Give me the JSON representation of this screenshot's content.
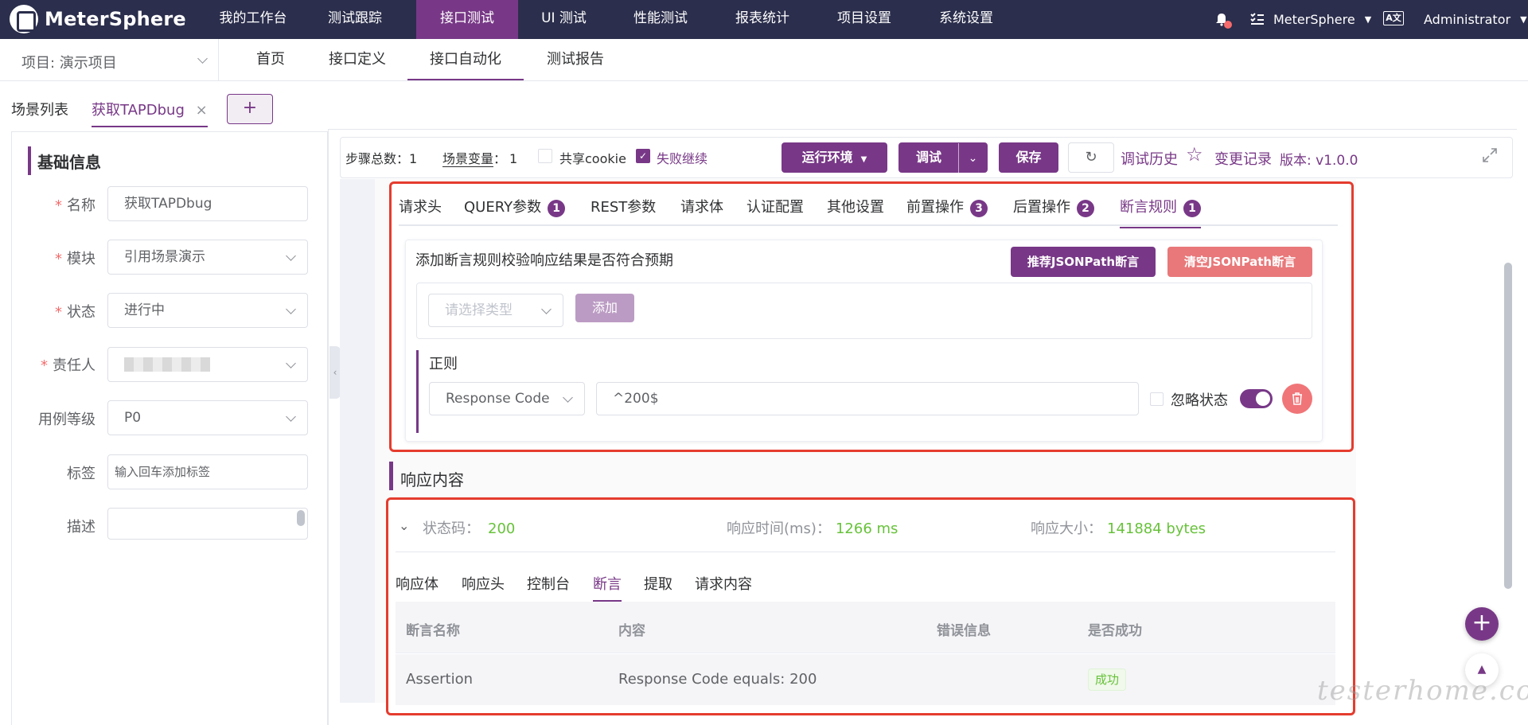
{
  "app": {
    "name": "MeterSphere"
  },
  "topnav": {
    "items": [
      "我的工作台",
      "测试跟踪",
      "接口测试",
      "UI 测试",
      "性能测试",
      "报表统计",
      "项目设置",
      "系统设置"
    ],
    "workspace": "MeterSphere",
    "user": "Administrator"
  },
  "subnav": {
    "project": "项目: 演示项目",
    "items": [
      "首页",
      "接口定义",
      "接口自动化",
      "测试报告"
    ]
  },
  "scene_tabs": {
    "list": "场景列表",
    "current": "获取TAPDbug",
    "add": "+"
  },
  "basic_info": {
    "title": "基础信息",
    "fields": [
      {
        "label": "名称",
        "value": "获取TAPDbug",
        "required": true
      },
      {
        "label": "模块",
        "value": "引用场景演示",
        "required": true
      },
      {
        "label": "状态",
        "value": "进行中",
        "required": true
      },
      {
        "label": "责任人",
        "value": "",
        "required": true
      },
      {
        "label": "用例等级",
        "value": "P0",
        "required": false
      },
      {
        "label": "标签",
        "value": "",
        "placeholder": "输入回车添加标签",
        "required": false
      },
      {
        "label": "描述",
        "value": "",
        "required": false
      }
    ]
  },
  "toolbar": {
    "steps_label": "步骤总数：",
    "steps_value": "1",
    "vars_label": "场景变量",
    "vars_colon": "：",
    "vars_value": "1",
    "share_cookie": "共享cookie",
    "fail_continue": "失败继续",
    "env_btn": "运行环境",
    "debug_btn": "调试",
    "save_btn": "保存",
    "history": "调试历史",
    "changelog": "变更记录",
    "version": "版本: v1.0.0"
  },
  "request_tabs": [
    {
      "label": "请求头",
      "badge": ""
    },
    {
      "label": "QUERY参数",
      "badge": "1"
    },
    {
      "label": "REST参数",
      "badge": ""
    },
    {
      "label": "请求体",
      "badge": ""
    },
    {
      "label": "认证配置",
      "badge": ""
    },
    {
      "label": "其他设置",
      "badge": ""
    },
    {
      "label": "前置操作",
      "badge": "3"
    },
    {
      "label": "后置操作",
      "badge": "2"
    },
    {
      "label": "断言规则",
      "badge": "1"
    }
  ],
  "assertion": {
    "desc": "添加断言规则校验响应结果是否符合预期",
    "recommend_btn": "推荐JSONPath断言",
    "clear_btn": "清空JSONPath断言",
    "type_placeholder": "请选择类型",
    "add_btn": "添加",
    "regex_title": "正则",
    "regex_subject": "Response Code",
    "regex_expr": "^200$",
    "ignore_status": "忽略状态"
  },
  "response": {
    "title": "响应内容",
    "status_label": "状态码：",
    "status_value": "200",
    "time_label": "响应时间(ms)：",
    "time_value": "1266 ms",
    "size_label": "响应大小：",
    "size_value": "141884 bytes",
    "tabs": [
      "响应体",
      "响应头",
      "控制台",
      "断言",
      "提取",
      "请求内容"
    ],
    "table": {
      "headers": [
        "断言名称",
        "内容",
        "错误信息",
        "是否成功"
      ],
      "rows": [
        {
          "name": "Assertion",
          "content": "Response Code equals: 200",
          "error": "",
          "result": "成功"
        }
      ]
    }
  },
  "watermark": "testerhome.com",
  "colors": {
    "brand": "#783887",
    "nav": "#2b2e4c",
    "success": "#67c23a",
    "danger": "#f56c6c",
    "highlight": "#e53c2e"
  }
}
